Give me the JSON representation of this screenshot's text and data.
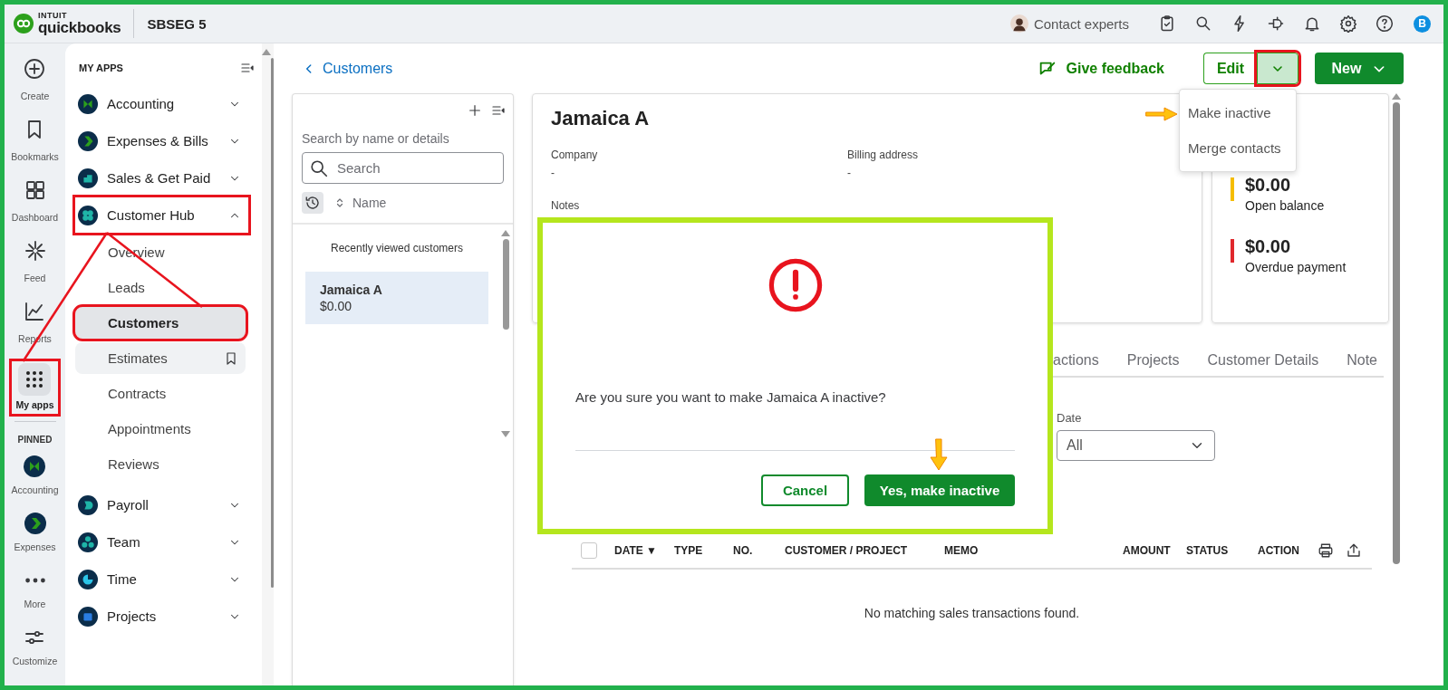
{
  "top_bar": {
    "brand_top": "INTUIT",
    "brand": "quickbooks",
    "company": "SBSEG 5",
    "contact": "Contact experts",
    "user_initial": "B"
  },
  "rail": {
    "items": [
      {
        "label": "Create",
        "selected": false,
        "highlighted": false
      },
      {
        "label": "Bookmarks",
        "selected": false,
        "highlighted": false
      },
      {
        "label": "Dashboard",
        "selected": false,
        "highlighted": false
      },
      {
        "label": "Feed",
        "selected": false,
        "highlighted": false
      },
      {
        "label": "Reports",
        "selected": false,
        "highlighted": false
      },
      {
        "label": "My apps",
        "selected": true,
        "highlighted": true
      }
    ],
    "pinned_title": "PINNED",
    "pinned": [
      {
        "label": "Accounting"
      },
      {
        "label": "Expenses"
      }
    ],
    "more": "More",
    "customize": "Customize"
  },
  "sidebar": {
    "title": "MY APPS",
    "apps": [
      {
        "label": "Accounting",
        "expanded": false,
        "highlighted": false
      },
      {
        "label": "Expenses & Bills",
        "expanded": false,
        "highlighted": false
      },
      {
        "label": "Sales & Get Paid",
        "expanded": false,
        "highlighted": false
      },
      {
        "label": "Customer Hub",
        "expanded": true,
        "highlighted": true,
        "children": [
          {
            "label": "Overview",
            "selected": false,
            "hovered": false,
            "highlighted": false
          },
          {
            "label": "Leads",
            "selected": false,
            "hovered": false,
            "highlighted": false
          },
          {
            "label": "Customers",
            "selected": true,
            "hovered": false,
            "highlighted": true
          },
          {
            "label": "Estimates",
            "selected": false,
            "hovered": true,
            "highlighted": false
          },
          {
            "label": "Contracts",
            "selected": false,
            "hovered": false,
            "highlighted": false
          },
          {
            "label": "Appointments",
            "selected": false,
            "hovered": false,
            "highlighted": false
          },
          {
            "label": "Reviews",
            "selected": false,
            "hovered": false,
            "highlighted": false
          }
        ]
      },
      {
        "label": "Payroll",
        "expanded": false,
        "highlighted": false
      },
      {
        "label": "Team",
        "expanded": false,
        "highlighted": false
      },
      {
        "label": "Time",
        "expanded": false,
        "highlighted": false
      },
      {
        "label": "Projects",
        "expanded": false,
        "highlighted": false
      }
    ]
  },
  "header": {
    "back_link": "Customers",
    "feedback": "Give feedback",
    "edit": "Edit",
    "more_toggle": {
      "highlighted": true
    },
    "new": "New"
  },
  "menu": {
    "items": [
      {
        "label": "Make inactive",
        "pointed": true
      },
      {
        "label": "Merge contacts",
        "pointed": false
      }
    ]
  },
  "customer_list": {
    "search_label": "Search by name or details",
    "search_placeholder": "Search",
    "sort_label": "Name",
    "section": "Recently viewed customers",
    "customers": [
      {
        "name": "Jamaica A",
        "balance": "$0.00",
        "selected": true
      }
    ]
  },
  "customer": {
    "name": "Jamaica A",
    "fields": [
      {
        "label": "Company",
        "value": "-"
      },
      {
        "label": "Billing address",
        "value": "-"
      }
    ],
    "notes_label": "Notes"
  },
  "balances": [
    {
      "amount": "$0.00",
      "label": "Open balance",
      "color": "#f5bd00"
    },
    {
      "amount": "$0.00",
      "label": "Overdue payment",
      "color": "#e0282c"
    }
  ],
  "tabs": [
    {
      "label": "actions",
      "selected": false
    },
    {
      "label": "Projects",
      "selected": false
    },
    {
      "label": "Customer Details",
      "selected": false
    },
    {
      "label": "Note",
      "selected": false
    }
  ],
  "filter": {
    "label": "Date",
    "value": "All"
  },
  "table": {
    "checked": false,
    "columns": [
      {
        "label": "DATE",
        "sort_mark": "▼"
      },
      {
        "label": "TYPE"
      },
      {
        "label": "NO."
      },
      {
        "label": "CUSTOMER / PROJECT"
      },
      {
        "label": "MEMO"
      },
      {
        "label": "AMOUNT"
      },
      {
        "label": "STATUS"
      },
      {
        "label": "ACTION"
      }
    ],
    "empty": "No matching sales transactions found."
  },
  "dialog": {
    "highlighted": true,
    "message": "Are you sure you want to make Jamaica A inactive?",
    "cancel": "Cancel",
    "confirm": "Yes, make inactive",
    "confirm_pointed": true
  }
}
